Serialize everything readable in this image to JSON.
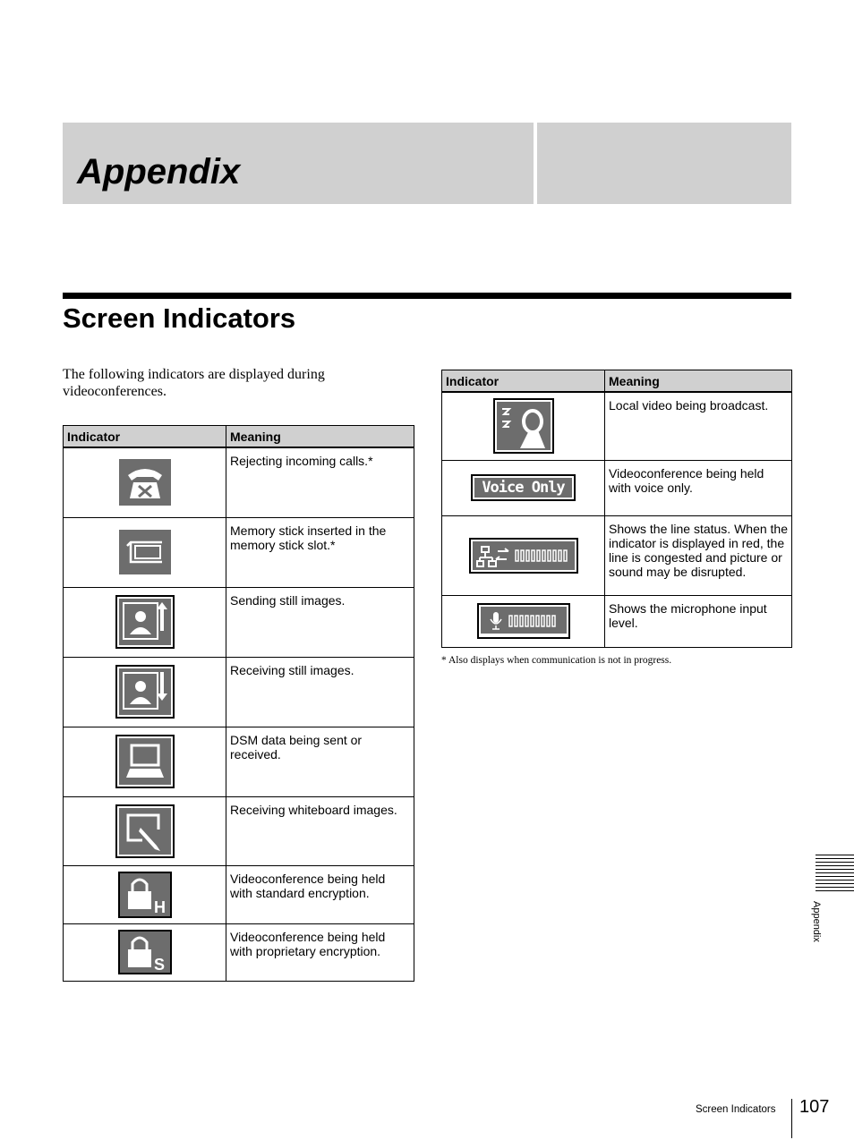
{
  "chapter_title": "Appendix",
  "section_title": "Screen Indicators",
  "intro": "The following indicators are displayed during videoconferences.",
  "table_left": {
    "headers": [
      "Indicator",
      "Meaning"
    ],
    "rows": [
      {
        "icon": "phone-reject-icon",
        "meaning": "Rejecting incoming calls.*"
      },
      {
        "icon": "memory-stick-icon",
        "meaning": "Memory stick inserted in the memory stick slot.*"
      },
      {
        "icon": "send-still-image-icon",
        "meaning": "Sending still images."
      },
      {
        "icon": "receive-still-image-icon",
        "meaning": "Receiving still images."
      },
      {
        "icon": "dsm-computer-icon",
        "meaning": "DSM data being sent or received."
      },
      {
        "icon": "whiteboard-icon",
        "meaning": "Receiving whiteboard images."
      },
      {
        "icon": "lock-h-icon",
        "meaning": "Videoconference being held with standard encryption."
      },
      {
        "icon": "lock-s-icon",
        "meaning": "Videoconference being held with proprietary encryption."
      }
    ]
  },
  "table_right": {
    "headers": [
      "Indicator",
      "Meaning"
    ],
    "rows": [
      {
        "icon": "broadcast-dish-icon",
        "meaning": "Local video being broadcast."
      },
      {
        "icon": "voice-only-icon",
        "label": "Voice Only",
        "meaning": "Videoconference being held with voice only."
      },
      {
        "icon": "line-status-icon",
        "meaning": "Shows the line status. When the indicator is displayed in red, the line is congested and picture or sound may be disrupted."
      },
      {
        "icon": "mic-level-icon",
        "meaning": "Shows the microphone input level."
      }
    ]
  },
  "footnote": "*   Also displays when communication is not in progress.",
  "side_tab": "Appendix",
  "footer": {
    "section": "Screen Indicators",
    "page": "107"
  },
  "colors": {
    "icon_gray": "#6d6d6d",
    "band_gray": "#d0d0d0"
  }
}
